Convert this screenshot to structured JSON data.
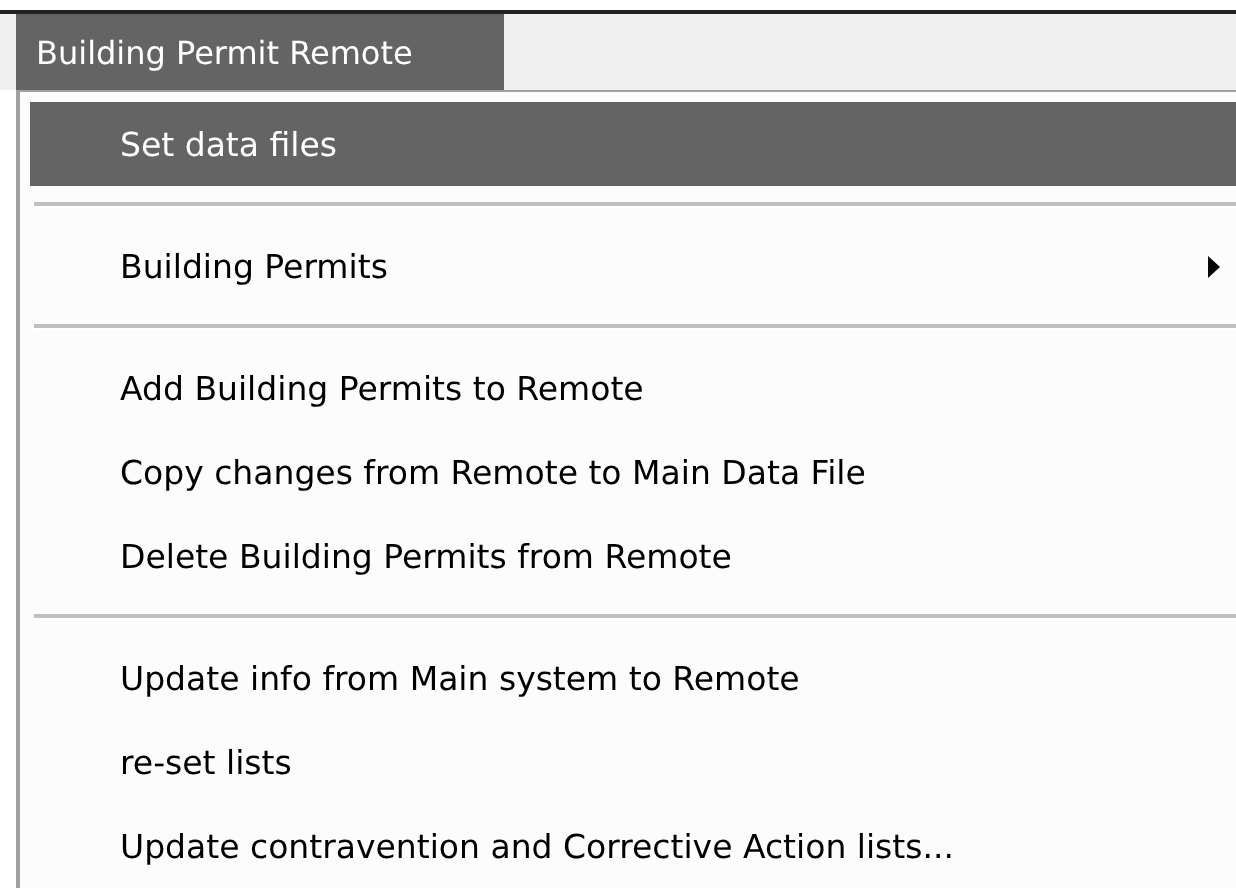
{
  "menu_bar": [
    {
      "label": "Building Permit Remote",
      "selected": true
    }
  ],
  "menu_groups": [
    [
      {
        "label": "Set data files",
        "kind": "action",
        "selected": true
      }
    ],
    [
      {
        "label": "Building Permits",
        "kind": "submenu",
        "selected": false
      }
    ],
    [
      {
        "label": "Add Building Permits to Remote",
        "kind": "action",
        "selected": false
      },
      {
        "label": "Copy changes from Remote to Main Data File",
        "kind": "action",
        "selected": false
      },
      {
        "label": "Delete Building Permits  from Remote",
        "kind": "action",
        "selected": false
      }
    ],
    [
      {
        "label": "Update info from Main system to Remote",
        "kind": "action",
        "selected": false
      },
      {
        "label": "re-set lists",
        "kind": "action",
        "selected": false
      },
      {
        "label": "Update contravention and Corrective Action lists...",
        "kind": "action",
        "selected": false
      }
    ]
  ]
}
